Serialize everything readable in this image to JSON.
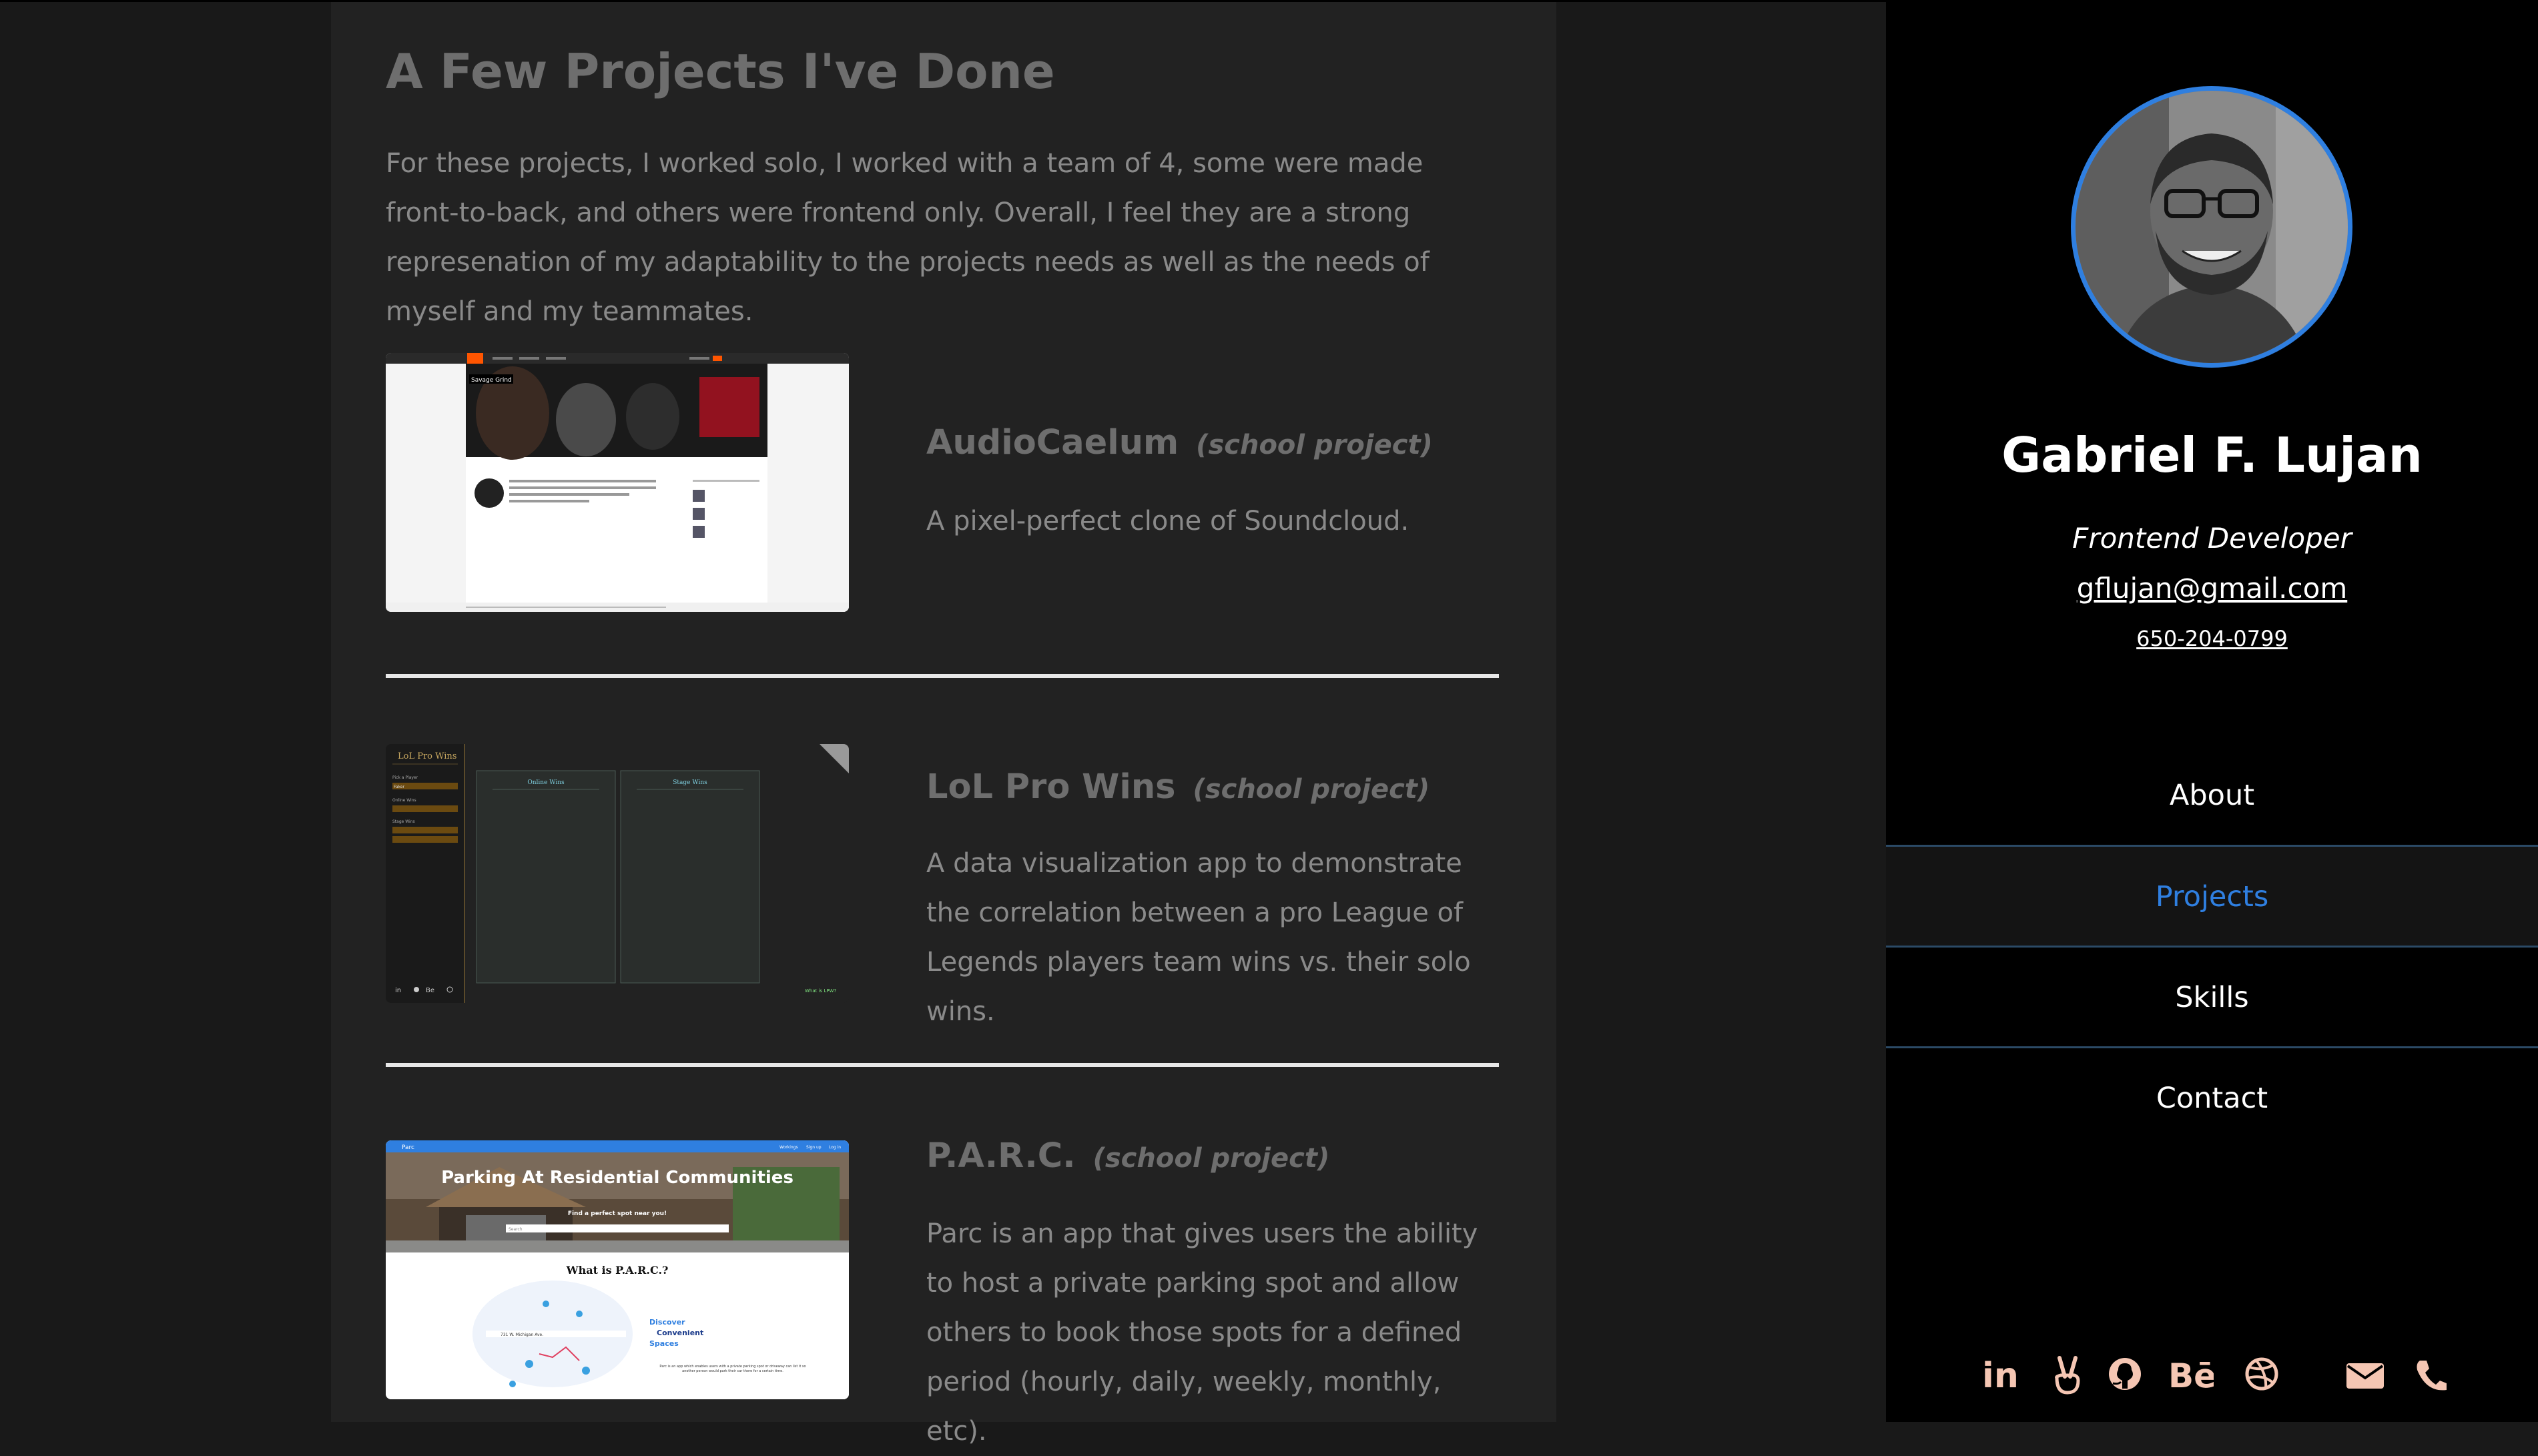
{
  "projects_section": {
    "title": "A Few Projects I've Done",
    "intro": "For these projects, I worked solo, I worked with a team of 4, some were made front-to-back, and others were frontend only. Overall, I feel they are a strong represenation of my adaptability to the projects needs as well as the needs of myself and my teammates.",
    "projects": [
      {
        "name": "AudioCaelum",
        "tag": "(school project)",
        "description": "A pixel-perfect clone of Soundcloud.",
        "thumbnail_label": "Savage Grind"
      },
      {
        "name": "LoL Pro Wins",
        "tag": "(school project)",
        "description": "A data visualization app to demonstrate the correlation between a pro League of Legends players team wins vs. their solo wins.",
        "thumbnail_brand": "LoL Pro Wins",
        "thumbnail_panel_1": "Online Wins",
        "thumbnail_panel_2": "Stage Wins",
        "thumbnail_footer": "What is LPW?",
        "thumbnail_menu": [
          "Pick a Player",
          "Faker",
          "Online Wins",
          "Stage Wins"
        ]
      },
      {
        "name": "P.A.R.C.",
        "tag": "(school project)",
        "description": "Parc is an app that gives users the ability to host a private parking spot and allow others to book those spots for a defined period (hourly, daily, weekly, monthly, etc).",
        "thumbnail_brand": "Parc",
        "thumbnail_links": [
          "Workings",
          "Sign up",
          "Log in"
        ],
        "thumbnail_hero": "Parking At Residential Communities",
        "thumbnail_subhero": "Find a perfect spot near you!",
        "thumbnail_search": "Search",
        "thumbnail_heading": "What is P.A.R.C.?",
        "thumbnail_tagline": [
          "Discover",
          "Convenient",
          "Spaces"
        ],
        "thumbnail_address": "731 W. Michigan Ave.",
        "thumbnail_blurb": "Parc is an app which enables users with a private parking spot or driveway can list it so another person would park their car there for a certain time."
      }
    ]
  },
  "sidebar": {
    "name": "Gabriel F. Lujan",
    "role": "Frontend Developer",
    "email": "gflujan@gmail.com",
    "phone": "650-204-0799",
    "nav": [
      {
        "label": "About",
        "active": false
      },
      {
        "label": "Projects",
        "active": true
      },
      {
        "label": "Skills",
        "active": false
      },
      {
        "label": "Contact",
        "active": false
      }
    ],
    "social_icons": [
      "linkedin-icon",
      "angellist-icon",
      "github-icon",
      "behance-icon",
      "dribbble-icon",
      "email-icon",
      "phone-icon"
    ]
  },
  "colors": {
    "page_bg": "#191919",
    "content_bg": "#222222",
    "sidebar_bg": "#000000",
    "accent": "#2f7fe0",
    "social_icon": "#f5c6b3"
  }
}
